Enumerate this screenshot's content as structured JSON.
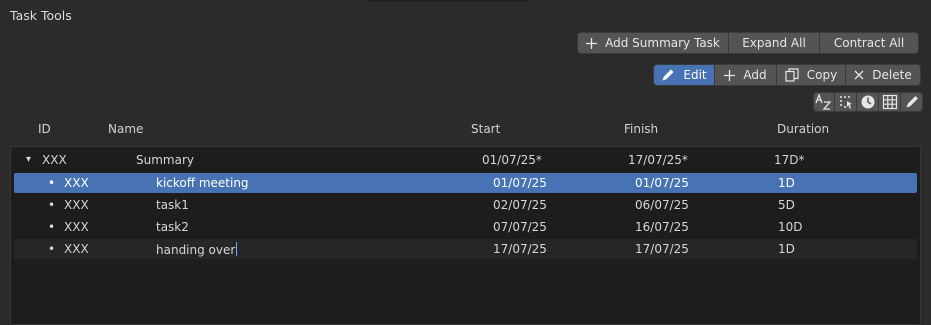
{
  "panel": {
    "title": "Task Tools"
  },
  "toolbar1": {
    "add_summary_label": "Add Summary Task",
    "expand_all_label": "Expand All",
    "contract_all_label": "Contract All"
  },
  "toolbar2": {
    "edit_label": "Edit",
    "add_label": "Add",
    "copy_label": "Copy",
    "delete_label": "Delete",
    "active_item": "Edit"
  },
  "icon_toolbar": [
    "sort-alpha-icon",
    "select-dots-icon",
    "clock-icon",
    "grid-icon",
    "pencil-icon"
  ],
  "columns": {
    "id": "ID",
    "name": "Name",
    "start": "Start",
    "finish": "Finish",
    "duration": "Duration"
  },
  "rows": [
    {
      "marker": "▾",
      "id": "XXX",
      "name": "Summary",
      "start": "01/07/25*",
      "finish": "17/07/25*",
      "duration": "17D*",
      "selected": false
    },
    {
      "marker": "•",
      "id": "XXX",
      "name": "kickoff meeting",
      "start": "01/07/25",
      "finish": "01/07/25",
      "duration": "1D",
      "selected": true
    },
    {
      "marker": "•",
      "id": "XXX",
      "name": "task1",
      "start": "02/07/25",
      "finish": "06/07/25",
      "duration": "5D",
      "selected": false
    },
    {
      "marker": "•",
      "id": "XXX",
      "name": "task2",
      "start": "07/07/25",
      "finish": "16/07/25",
      "duration": "10D",
      "selected": false
    },
    {
      "marker": "•",
      "id": "XXX",
      "name": "handing over",
      "start": "17/07/25",
      "finish": "17/07/25",
      "duration": "1D",
      "selected": false,
      "editing": true
    }
  ],
  "colors": {
    "accent": "#4772b3",
    "panel_bg": "#2b2b2b",
    "list_bg": "#1d1d1d",
    "button_bg": "#545454"
  }
}
